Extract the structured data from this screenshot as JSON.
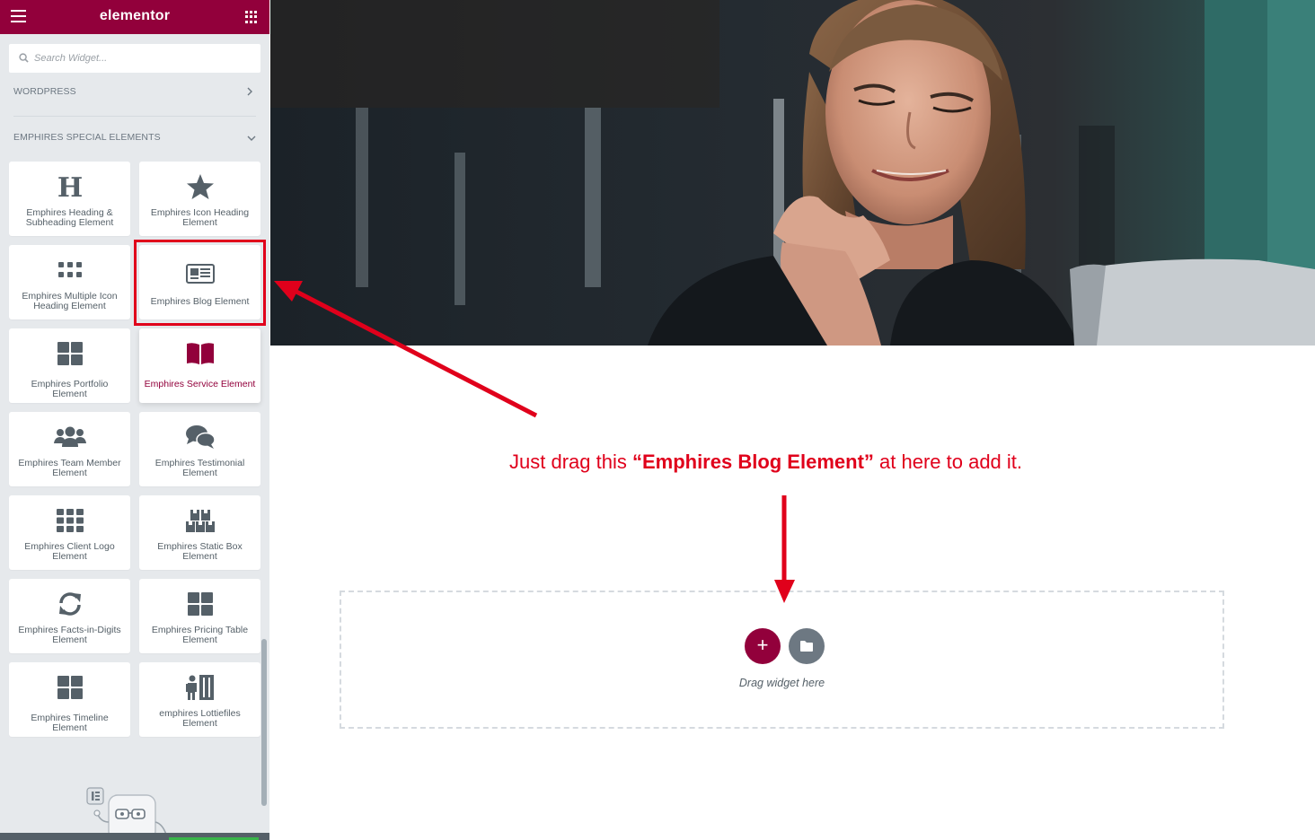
{
  "app": {
    "brand": "elementor",
    "accent_color": "#92003b"
  },
  "sidebar": {
    "menu_icon": "hamburger-icon",
    "apps_icon": "grid-icon",
    "search": {
      "placeholder": "Search Widget...",
      "value": ""
    },
    "categories": [
      {
        "label": "WORDPRESS",
        "state": "collapsed"
      },
      {
        "label": "EMPHIRES SPECIAL ELEMENTS",
        "state": "expanded"
      }
    ],
    "widgets": [
      {
        "title": "Emphires Heading & Subheading Element",
        "icon": "heading-icon"
      },
      {
        "title": "Emphires Icon Heading Element",
        "icon": "star-icon"
      },
      {
        "title": "Emphires Multiple Icon Heading Element",
        "icon": "dots-grid-icon"
      },
      {
        "title": "Emphires Blog Element",
        "icon": "newspaper-icon"
      },
      {
        "title": "Emphires Portfolio Element",
        "icon": "th-large-icon"
      },
      {
        "title": "Emphires Service Element",
        "icon": "book-open-icon",
        "active": true
      },
      {
        "title": "Emphires Team Member Element",
        "icon": "users-icon"
      },
      {
        "title": "Emphires Testimonial Element",
        "icon": "comments-icon"
      },
      {
        "title": "Emphires Client Logo Element",
        "icon": "th-icon"
      },
      {
        "title": "Emphires Static Box Element",
        "icon": "boxes-icon"
      },
      {
        "title": "Emphires Facts-in-Digits Element",
        "icon": "sync-icon"
      },
      {
        "title": "Emphires Pricing Table Element",
        "icon": "th-large-icon"
      },
      {
        "title": "Emphires Timeline Element",
        "icon": "th-large-icon"
      },
      {
        "title": "emphires Lottiefiles Element",
        "icon": "person-door-icon"
      }
    ],
    "highlighted_widget": "Emphires Blog Element",
    "highlight_color": "#e0001b"
  },
  "canvas": {
    "instruction": {
      "prefix": "Just drag this ",
      "emphasis": "“Emphires Blog Element”",
      "suffix": " at here to add it.",
      "color": "#e0001b"
    },
    "dropzone": {
      "add_icon": "plus-icon",
      "library_icon": "folder-icon",
      "add_label": "+",
      "text": "Drag widget here"
    }
  }
}
